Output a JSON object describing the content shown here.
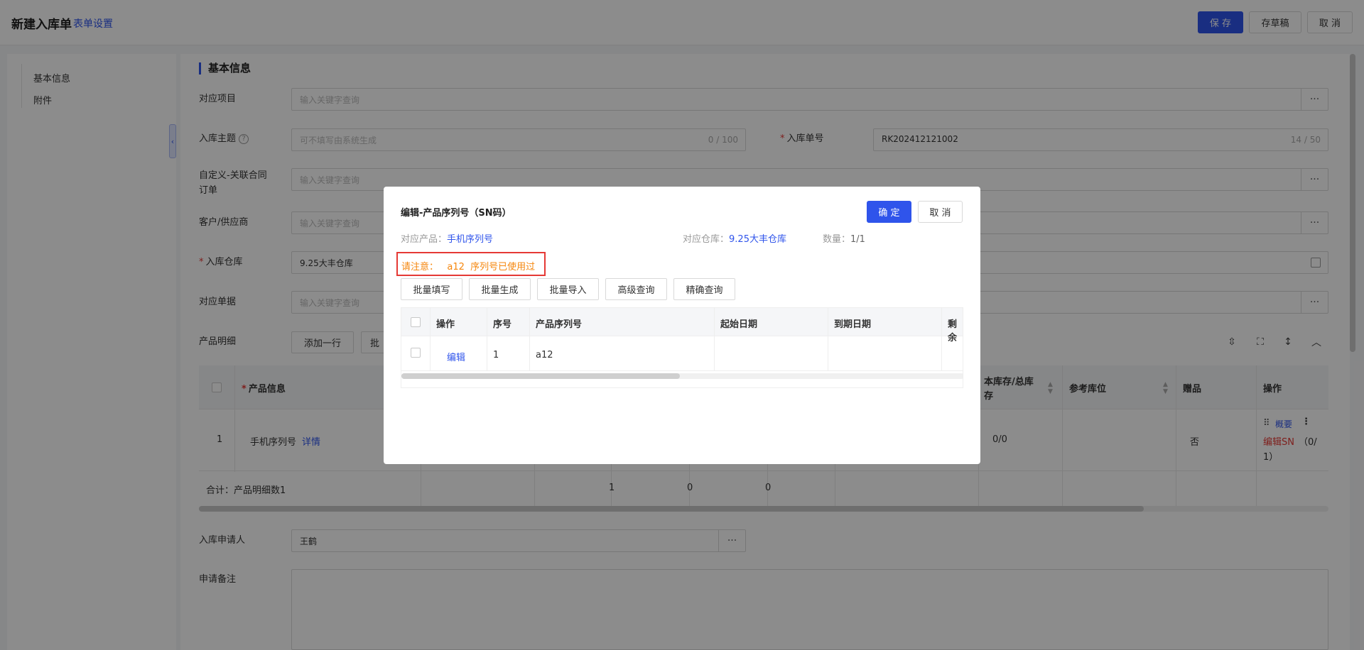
{
  "header": {
    "title": "新建入库单",
    "form_settings": "表单设置",
    "save": "保 存",
    "draft": "存草稿",
    "cancel": "取 消"
  },
  "leftnav": {
    "items": [
      "基本信息",
      "附件"
    ]
  },
  "section": {
    "title": "基本信息"
  },
  "fields": {
    "project_label": "对应项目",
    "project_placeholder": "输入关键字查询",
    "subject_label": "入库主题",
    "subject_placeholder": "可不填写由系统生成",
    "subject_count": "0 / 100",
    "order_no_label": "入库单号",
    "order_no_value": "RK202412121002",
    "order_no_count": "14 / 50",
    "contract_label_1": "自定义-关联合同",
    "contract_label_2": "订单",
    "contract_placeholder": "输入关键字查询",
    "customer_label": "客户/供应商",
    "customer_placeholder": "输入关键字查询",
    "warehouse_label": "入库仓库",
    "warehouse_value": "9.25大丰仓库",
    "document_label": "对应单据",
    "document_placeholder": "输入关键字查询",
    "product_detail_label": "产品明细",
    "add_row": "添加一行",
    "batch_partial": "批",
    "applicant_label": "入库申请人",
    "applicant_value": "王鹤",
    "remark_label": "申请备注"
  },
  "product_table": {
    "headers": {
      "product_info": "产品信息",
      "stock_line1": "本库存/总库",
      "stock_line2": "存",
      "ref_location": "参考库位",
      "gift": "赠品",
      "action": "操作"
    },
    "row": {
      "index": "1",
      "product": "手机序列号",
      "detail_link": "详情",
      "stock": "0/0",
      "gift": "否",
      "summary_link": "概要",
      "edit_sn": "编辑SN",
      "sn_count_1": "（0/",
      "sn_count_2": "1）"
    },
    "total": {
      "label": "合计：产品明细数1",
      "v1": "1",
      "v2": "0",
      "v3": "0"
    }
  },
  "modal": {
    "title": "编辑-产品序列号（SN码）",
    "confirm": "确 定",
    "cancel": "取 消",
    "product_label": "对应产品：",
    "product_value": "手机序列号",
    "warehouse_label": "对应仓库：",
    "warehouse_value": "9.25大丰仓库",
    "qty_label": "数量：",
    "qty_value": "1/1",
    "warning": "请注意：   a12  序列号已使用过",
    "buttons": [
      "批量填写",
      "批量生成",
      "批量导入",
      "高级查询",
      "精确查询"
    ],
    "table": {
      "headers": [
        "操作",
        "序号",
        "产品序列号",
        "起始日期",
        "到期日期",
        "剩余"
      ],
      "row": {
        "edit": "编辑",
        "index": "1",
        "sn": "a12"
      }
    }
  }
}
